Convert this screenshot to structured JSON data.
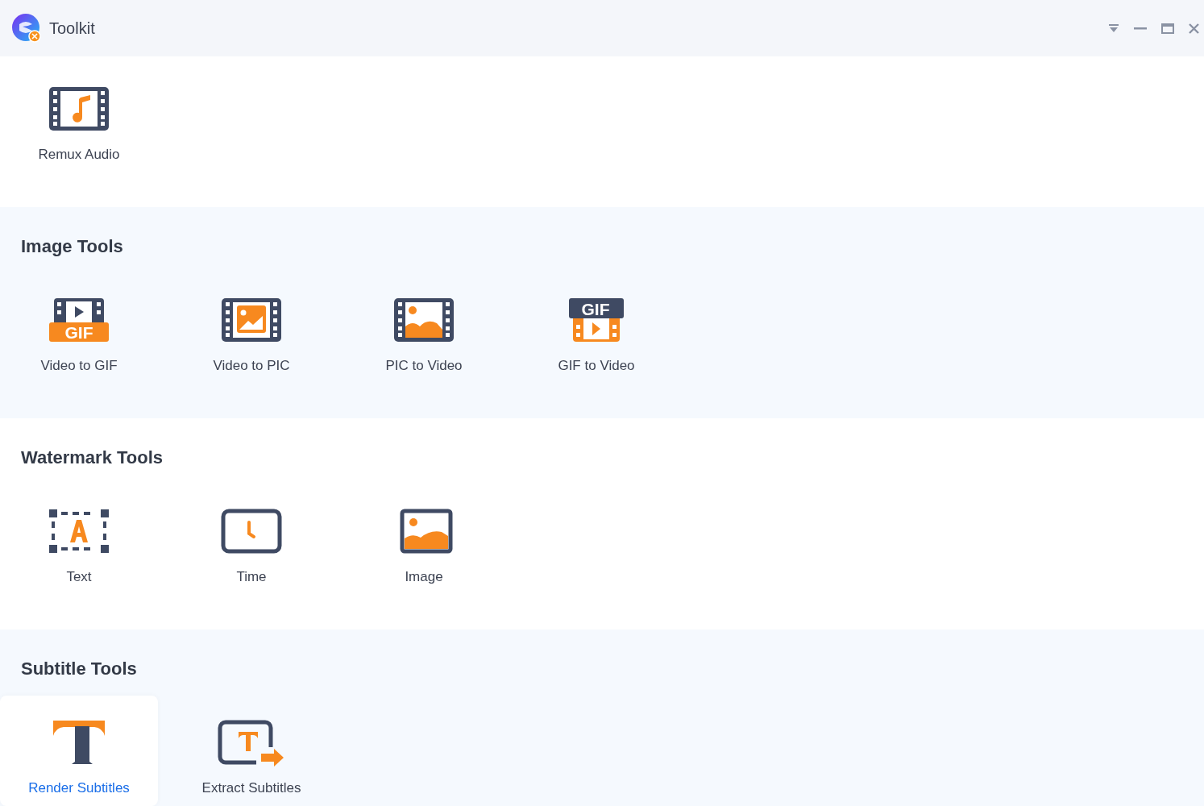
{
  "window": {
    "title": "Toolkit"
  },
  "sections": [
    {
      "tools": [
        {
          "label": "Remux Audio",
          "kind": "remux",
          "selected": false
        }
      ]
    },
    {
      "title": "Image Tools",
      "tools": [
        {
          "label": "Video to GIF",
          "kind": "videogif",
          "badge": "GIF",
          "selected": false
        },
        {
          "label": "Video to PIC",
          "kind": "videopic",
          "selected": false
        },
        {
          "label": "PIC to Video",
          "kind": "picvideo",
          "selected": false
        },
        {
          "label": "GIF to Video",
          "kind": "gifvideo",
          "badge": "GIF",
          "selected": false
        }
      ]
    },
    {
      "title": "Watermark Tools",
      "tools": [
        {
          "label": "Text",
          "kind": "text",
          "selected": false
        },
        {
          "label": "Time",
          "kind": "time",
          "selected": false
        },
        {
          "label": "Image",
          "kind": "image",
          "selected": false
        }
      ]
    },
    {
      "title": "Subtitle Tools",
      "tools": [
        {
          "label": "Render Subtitles",
          "kind": "render",
          "selected": true
        },
        {
          "label": "Extract Subtitles",
          "kind": "extract",
          "selected": false
        }
      ]
    }
  ]
}
